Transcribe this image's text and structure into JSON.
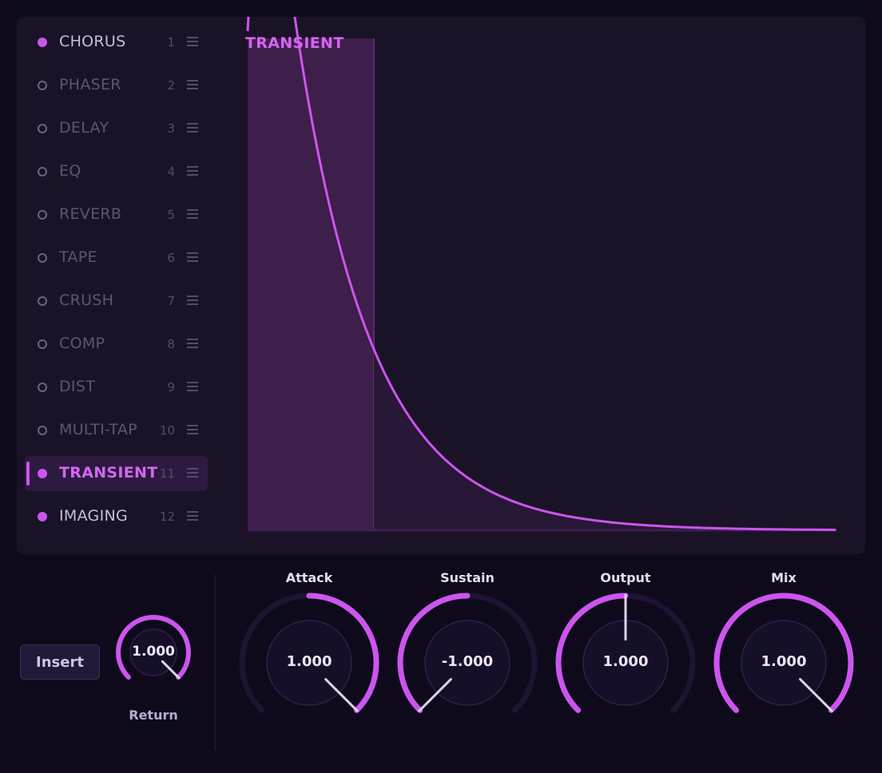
{
  "effects": [
    {
      "label": "CHORUS",
      "num": "1",
      "enabled": true,
      "selected": false
    },
    {
      "label": "PHASER",
      "num": "2",
      "enabled": false,
      "selected": false
    },
    {
      "label": "DELAY",
      "num": "3",
      "enabled": false,
      "selected": false
    },
    {
      "label": "EQ",
      "num": "4",
      "enabled": false,
      "selected": false
    },
    {
      "label": "REVERB",
      "num": "5",
      "enabled": false,
      "selected": false
    },
    {
      "label": "TAPE",
      "num": "6",
      "enabled": false,
      "selected": false
    },
    {
      "label": "CRUSH",
      "num": "7",
      "enabled": false,
      "selected": false
    },
    {
      "label": "COMP",
      "num": "8",
      "enabled": false,
      "selected": false
    },
    {
      "label": "DIST",
      "num": "9",
      "enabled": false,
      "selected": false
    },
    {
      "label": "MULTI-TAP",
      "num": "10",
      "enabled": false,
      "selected": false
    },
    {
      "label": "TRANSIENT",
      "num": "11",
      "enabled": true,
      "selected": true
    },
    {
      "label": "IMAGING",
      "num": "12",
      "enabled": true,
      "selected": false
    }
  ],
  "visualizer": {
    "title": "TRANSIENT"
  },
  "insert_label": "Insert",
  "return_knob": {
    "label": "Return",
    "value": "1.000",
    "level": 1.0
  },
  "knobs": [
    {
      "label": "Attack",
      "value": "1.000",
      "level": 1.0,
      "bipolar": true
    },
    {
      "label": "Sustain",
      "value": "-1.000",
      "level": -1.0,
      "bipolar": true
    },
    {
      "label": "Output",
      "value": "1.000",
      "level": 0.5,
      "bipolar": false
    },
    {
      "label": "Mix",
      "value": "1.000",
      "level": 1.0,
      "bipolar": false
    }
  ],
  "colors": {
    "accent": "#cc55ee",
    "background": "#0e0a1c",
    "panel": "#1a1226"
  }
}
